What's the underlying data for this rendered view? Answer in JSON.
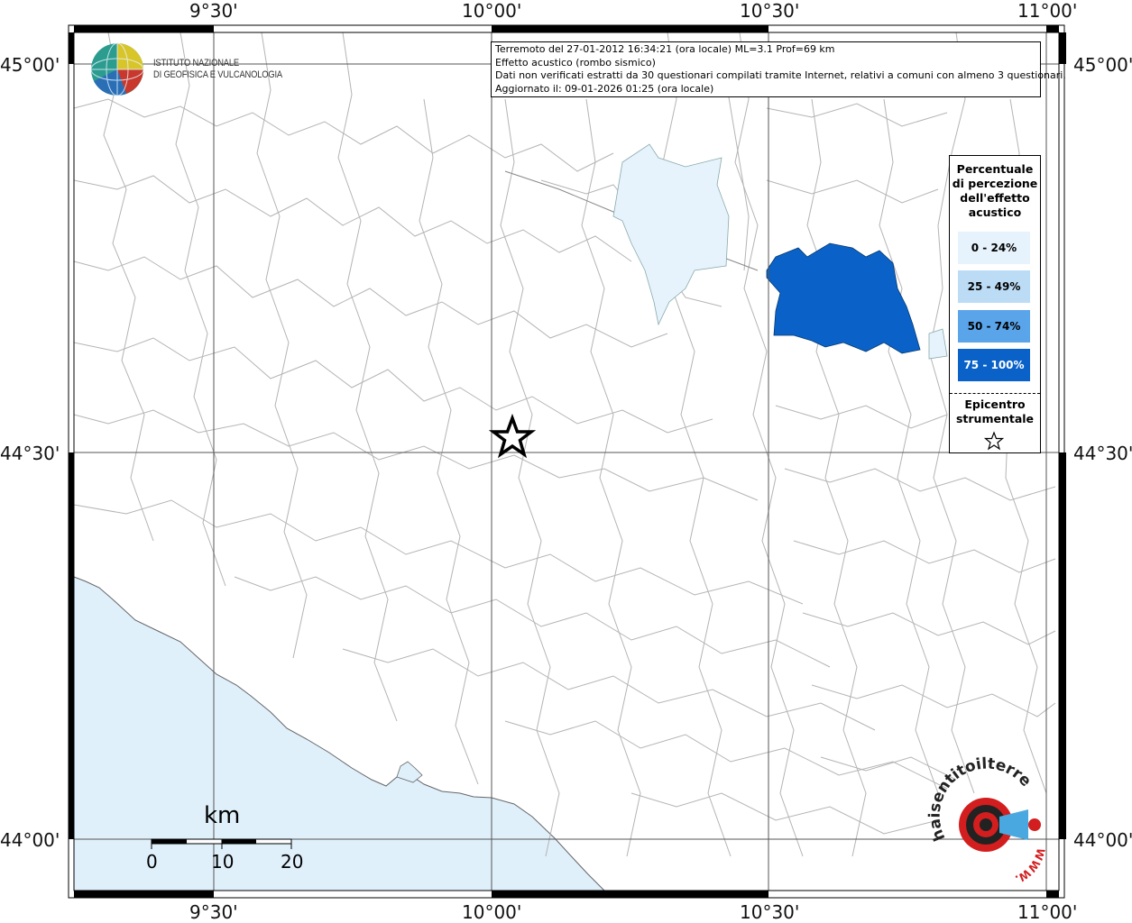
{
  "map": {
    "lon_labels": [
      "9°30'",
      "10°00'",
      "10°30'",
      "11°00'"
    ],
    "lat_labels": [
      "45°00'",
      "44°30'",
      "44°00'"
    ]
  },
  "logo": {
    "line1": "ISTITUTO NAZIONALE",
    "line2": "DI GEOFISICA E VULCANOLOGIA"
  },
  "info": {
    "line1": "Terremoto del 27-01-2012 16:34:21 (ora locale) ML=3.1 Prof=69 km",
    "line2": "Effetto acustico (rombo sismico)",
    "line3": "Dati non verificati estratti da 30 questionari compilati tramite Internet, relativi a comuni con almeno 3 questionari.",
    "line4": "Aggiornato il: 09-01-2026 01:25 (ora locale)"
  },
  "legend": {
    "title_lines": [
      "Percentuale",
      "di percezione",
      "dell'effetto",
      "acustico"
    ],
    "classes": [
      {
        "label": "0 - 24%",
        "color": "#e6f2fc",
        "text_color": "#000000"
      },
      {
        "label": "25 - 49%",
        "color": "#bcdcf6",
        "text_color": "#000000"
      },
      {
        "label": "50 - 74%",
        "color": "#5aa4ea",
        "text_color": "#000000"
      },
      {
        "label": "75 - 100%",
        "color": "#0a62c8",
        "text_color": "#ffffff"
      }
    ],
    "epicenter_lines": [
      "Epicentro",
      "strumentale"
    ]
  },
  "scale": {
    "unit": "km",
    "ticks": [
      "0",
      "10",
      "20"
    ]
  },
  "watermark": {
    "text": "haisentitoilterremoto.it",
    "www": "WWW."
  },
  "colors": {
    "sea": "#dff0fb",
    "border_lines": "#b4b4b4",
    "grid": "#555555",
    "frame": "#000000"
  }
}
